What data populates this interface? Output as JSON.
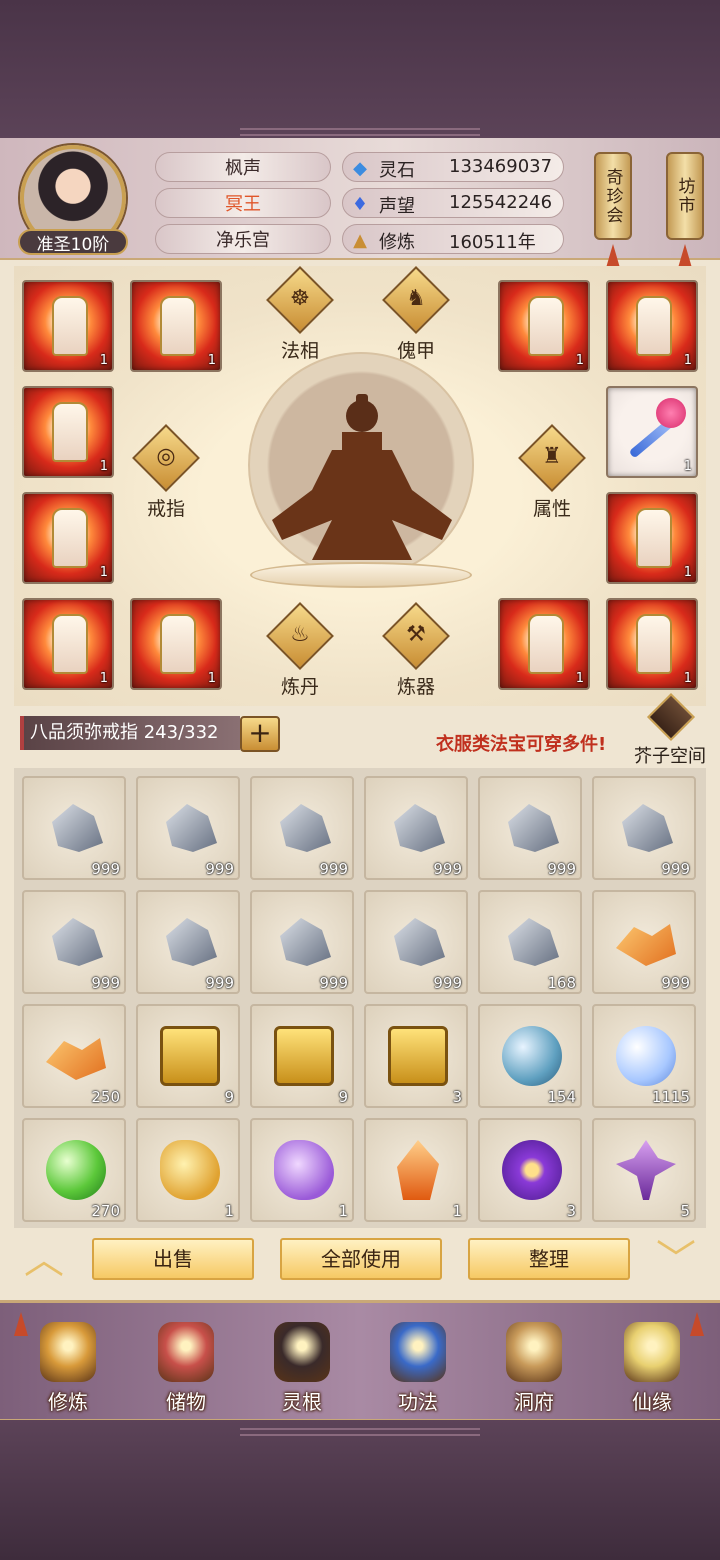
{
  "player": {
    "rank": "准圣10阶",
    "names": [
      "枫声",
      "冥王",
      "净乐宫"
    ],
    "highlight_color": "#e0562a"
  },
  "stats": [
    {
      "icon": "spirit-stone-icon",
      "glyph": "◆",
      "label": "灵石",
      "value": "133469037"
    },
    {
      "icon": "prestige-icon",
      "glyph": "♦",
      "label": "声望",
      "value": "125542246"
    },
    {
      "icon": "cultivation-icon",
      "glyph": "▲",
      "label": "修炼",
      "value": "160511年"
    }
  ],
  "side_buttons": [
    {
      "label": "奇珍会"
    },
    {
      "label": "坊市"
    }
  ],
  "equipment": {
    "slot_counts": [
      "1",
      "1",
      "1",
      "1",
      "1",
      "1",
      "1",
      "1",
      "1",
      "1",
      "1",
      "1"
    ],
    "buttons": [
      {
        "label": "法相",
        "glyph": "☸"
      },
      {
        "label": "傀甲",
        "glyph": "♞"
      },
      {
        "label": "戒指",
        "glyph": "◎"
      },
      {
        "label": "属性",
        "glyph": "♜"
      },
      {
        "label": "炼丹",
        "glyph": "♨"
      },
      {
        "label": "炼器",
        "glyph": "⚒"
      }
    ]
  },
  "bag": {
    "title": "八品须弥戒指 243/332",
    "plus": "+",
    "hint": "衣服类法宝可穿多件!",
    "space_label": "芥子空间"
  },
  "inventory": [
    {
      "icon": "ore",
      "count": "999"
    },
    {
      "icon": "ore",
      "count": "999"
    },
    {
      "icon": "ore",
      "count": "999"
    },
    {
      "icon": "ore",
      "count": "999"
    },
    {
      "icon": "ore",
      "count": "999"
    },
    {
      "icon": "ore",
      "count": "999"
    },
    {
      "icon": "ore",
      "count": "999"
    },
    {
      "icon": "ore",
      "count": "999"
    },
    {
      "icon": "ore",
      "count": "999"
    },
    {
      "icon": "ore",
      "count": "999"
    },
    {
      "icon": "ore",
      "count": "168"
    },
    {
      "icon": "amber",
      "count": "999"
    },
    {
      "icon": "amber",
      "count": "250"
    },
    {
      "icon": "chest",
      "count": "9"
    },
    {
      "icon": "chest",
      "count": "9"
    },
    {
      "icon": "chest",
      "count": "3"
    },
    {
      "icon": "orb-blue",
      "count": "154"
    },
    {
      "icon": "orb-white",
      "count": "1115"
    },
    {
      "icon": "orb-green",
      "count": "270"
    },
    {
      "icon": "swirl-gold",
      "count": "1"
    },
    {
      "icon": "swirl-purple",
      "count": "1"
    },
    {
      "icon": "flame-orange",
      "count": "1"
    },
    {
      "icon": "flower",
      "count": "3"
    },
    {
      "icon": "plant",
      "count": "5"
    }
  ],
  "actions": {
    "sell": "出售",
    "use_all": "全部使用",
    "sort": "整理"
  },
  "nav": [
    {
      "label": "修炼",
      "icon": "monk-icon"
    },
    {
      "label": "储物",
      "icon": "bag-icon"
    },
    {
      "label": "灵根",
      "icon": "spirit-root-icon"
    },
    {
      "label": "功法",
      "icon": "book-icon"
    },
    {
      "label": "洞府",
      "icon": "cave-icon"
    },
    {
      "label": "仙缘",
      "icon": "gourd-icon"
    }
  ]
}
